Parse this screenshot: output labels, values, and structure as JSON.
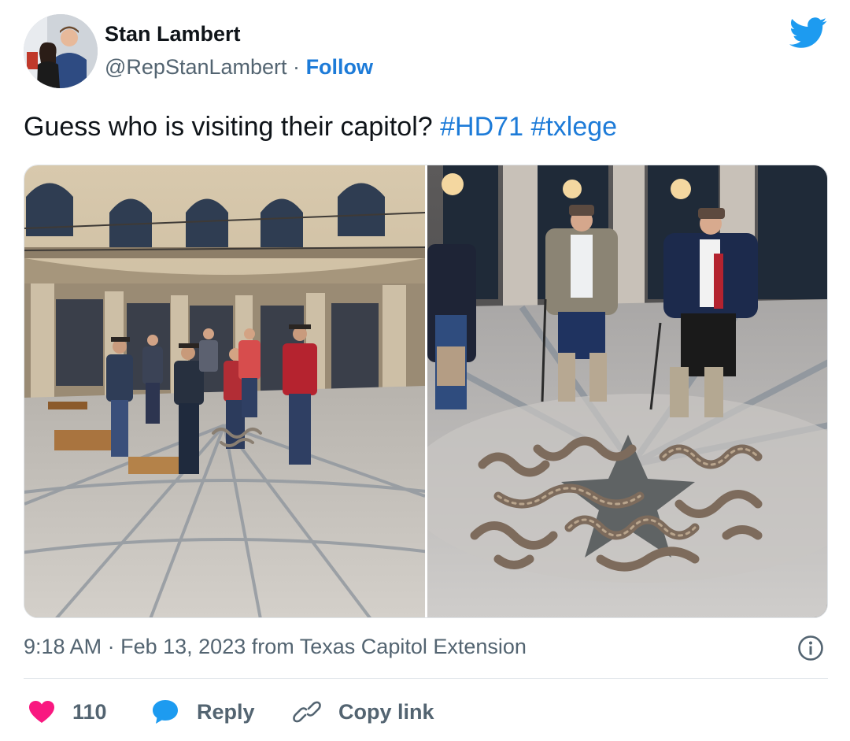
{
  "author": {
    "name": "Stan Lambert",
    "handle": "@RepStanLambert",
    "separator": "·",
    "follow_label": "Follow"
  },
  "tweet": {
    "text": "Guess who is visiting their capitol?",
    "hashtags": [
      "#HD71",
      "#txlege"
    ]
  },
  "media": {
    "photos": [
      {
        "name": "photo-rotunda-handlers"
      },
      {
        "name": "photo-rattlesnakes-on-seal"
      }
    ]
  },
  "meta": {
    "time": "9:18 AM",
    "separator": "·",
    "date": "Feb 13, 2023",
    "source_prefix": "from",
    "source": "Texas Capitol Extension"
  },
  "actions": {
    "like_count": "110",
    "reply_label": "Reply",
    "copy_link_label": "Copy link"
  },
  "colors": {
    "accent": "#1d7bd8",
    "heart": "#f91880",
    "reply_bubble": "#1d9bf0",
    "secondary_text": "#536471"
  },
  "icons": [
    "twitter-bird-icon",
    "info-icon",
    "heart-icon",
    "reply-bubble-icon",
    "link-icon"
  ]
}
